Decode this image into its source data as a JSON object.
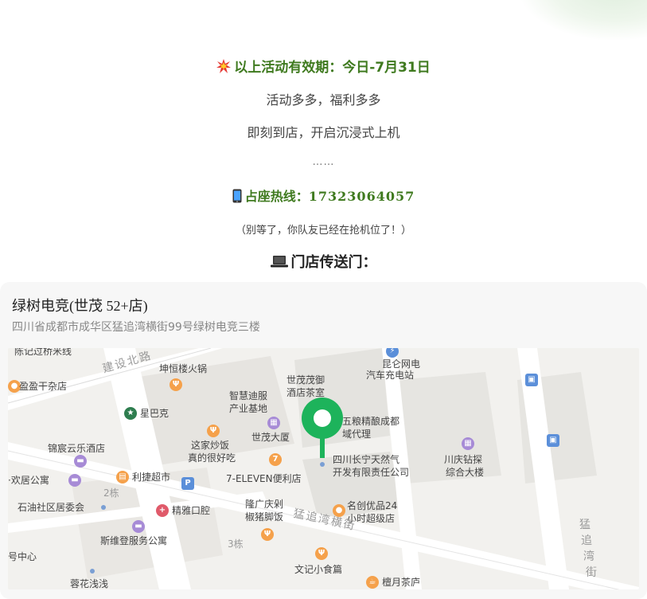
{
  "promo": {
    "title": "以上活动有效期：今日-7月31日",
    "line1": "活动多多，福利多多",
    "line2": "即刻到店，开启沉浸式上机",
    "ellipsis": "……"
  },
  "hotline": {
    "label": "占座热线：",
    "number": "17323064057"
  },
  "note": "（别等了，你队友已经在抢机位了！）",
  "portal_title": "门店传送门：",
  "store": {
    "name": "绿树电竞(世茂 52+店)",
    "address": "四川省成都市成华区猛追湾横街99号绿树电竞三楼"
  },
  "map": {
    "pin_color": "#1db35b",
    "labels": {
      "l1": "陈记过桥米线",
      "l2": "建设北路",
      "l3": "坤恒楼火锅",
      "l4": "盈盈干杂店",
      "l5": "世茂茂御",
      "l6": "酒店茶室",
      "l7": "昆仑网电",
      "l8": "汽车充电站",
      "l9": "智慧迪服",
      "l10": "产业基地",
      "l11": "星巴克",
      "l12": "五粮精酿成都",
      "l13": "域代理",
      "l14": "世茂大厦",
      "l15": "这家炒饭",
      "l16": "真的很好吃",
      "l17": "锦宸云乐酒店",
      "l18": "四川长宁天然气",
      "l19": "开发有限责任公司",
      "l20": "川庆钻探",
      "l21": "综合大楼",
      "l22": "·欢居公寓",
      "l23": "利捷超市",
      "l24": "7-ELEVEN便利店",
      "l25": "2栋",
      "l26": "石油社区居委会",
      "l27": "精雅口腔",
      "l28": "隆广庆剁",
      "l29": "椒猪脚饭",
      "l30": "名创优品24",
      "l31": "小时超级店",
      "l32": "猛追湾横街",
      "l33": "猛",
      "l34": "追",
      "l35": "湾",
      "l36": "街",
      "l37": "斯维登服务公寓",
      "l38": "3栋",
      "l39": "号中心",
      "l40": "文记小食篇",
      "l41": "蓉花浅浅",
      "l42": "檀月茶庐"
    }
  }
}
